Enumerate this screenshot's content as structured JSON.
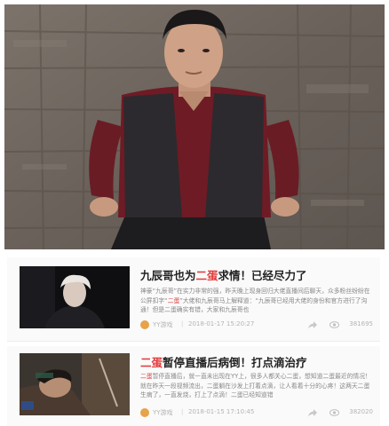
{
  "hero": {
    "image": "man in burgundy shirt and dark vest against wooden wall"
  },
  "articles": [
    {
      "title_prefix": "九辰哥也为",
      "title_highlight": "二蛋",
      "title_suffix": "求情！已经尽力了",
      "excerpt_prefix": "神豪“九辰哥”在实力非常的强，昨天晚上现身回归大佬直播间后聊天，众多粉丝纷纷在公屏扣字“",
      "excerpt_highlight": "二蛋",
      "excerpt_suffix": "”大佬和九辰哥马上解释道：“九辰哥已经用大佬的身份和官方进行了沟通！但是二蛋确实有错，大家和九辰哥也",
      "author": "YY游戏",
      "date": "2018-01-17 15:20:27",
      "views": "381695",
      "thumb_icon": "person-photo-icon"
    },
    {
      "title_highlight": "二蛋",
      "title_suffix": "暂停直播后病倒！打点滴治疗",
      "excerpt_prefix": "",
      "excerpt_highlight": "二蛋",
      "excerpt_suffix": "暂停直播后，就一直未出现在YY上，很多人都关心二蛋，想知道二蛋最近的情况！就在昨天一段视频流出，二蛋躺在沙发上打着点滴，让人看着十分的心疼！这两天二蛋生病了，一直发烧，打上了点滴！二蛋已经知道错",
      "author": "YY游戏",
      "date": "2018-01-15 17:10:45",
      "views": "382020",
      "thumb_icon": "person-photo-icon"
    }
  ],
  "meta_separator": "|",
  "colors": {
    "highlight": "#e13a3a",
    "avatar": "#e8a248"
  }
}
